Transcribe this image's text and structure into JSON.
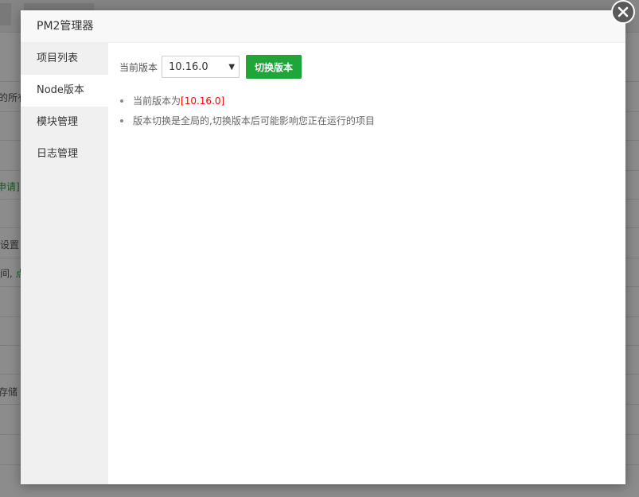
{
  "background": {
    "rows": [
      {
        "text": "的所有",
        "highlight": ""
      },
      {
        "text": "申请]",
        "highlight": "",
        "color": "green"
      },
      {
        "text": "设置",
        "highlight": ""
      },
      {
        "text": "间,",
        "highlight": "点"
      },
      {
        "text": "存储",
        "highlight": ""
      }
    ]
  },
  "modal": {
    "title": "PM2管理器",
    "close_icon": "close-icon",
    "sidebar": {
      "items": [
        {
          "label": "项目列表",
          "active": false
        },
        {
          "label": "Node版本",
          "active": true
        },
        {
          "label": "模块管理",
          "active": false
        },
        {
          "label": "日志管理",
          "active": false
        }
      ]
    },
    "version_panel": {
      "current_label": "当前版本",
      "select_value": "10.16.0",
      "switch_button_label": "切换版本",
      "tips": {
        "current_prefix": "当前版本为",
        "current_version": "[10.16.0]",
        "warning": "版本切换是全局的,切换版本后可能影响您正在运行的项目"
      }
    }
  },
  "colors": {
    "accent_green": "#20a53a",
    "version_red": "#ff0000",
    "overlay": "rgba(0,0,0,0.45)"
  }
}
